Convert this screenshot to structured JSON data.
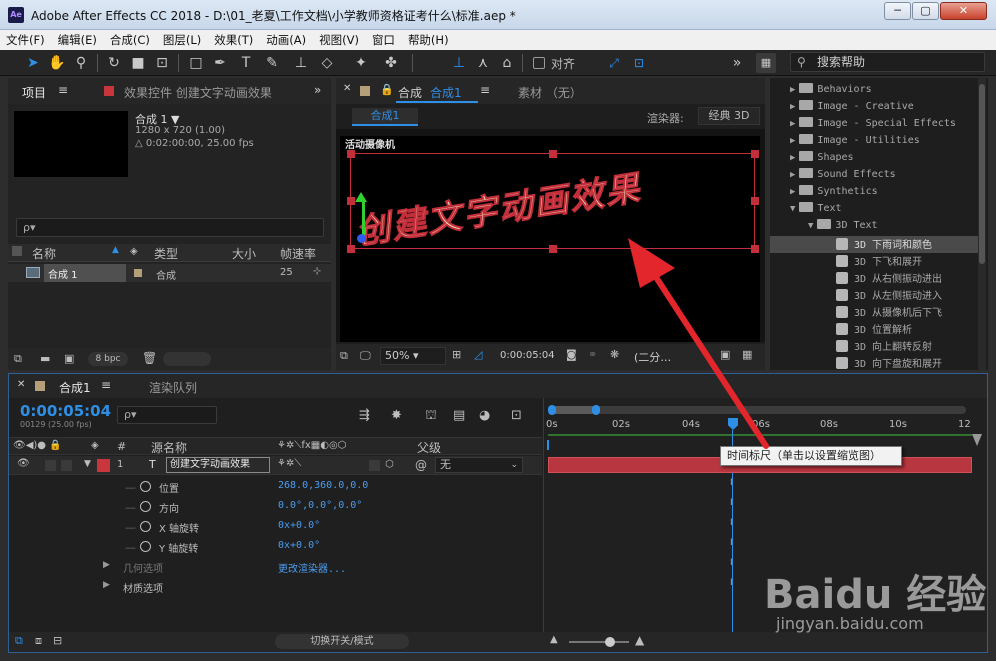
{
  "window": {
    "title": "Adobe After Effects CC 2018 - D:\\01_老夏\\工作文档\\小学教师资格证考什么\\标准.aep *",
    "app_icon": "Ae",
    "min": "─",
    "max": "▢",
    "close": "✕"
  },
  "menu": [
    "文件(F)",
    "编辑(E)",
    "合成(C)",
    "图层(L)",
    "效果(T)",
    "动画(A)",
    "视图(V)",
    "窗口",
    "帮助(H)"
  ],
  "toolbar": {
    "snap_label": "对齐",
    "search_label": "搜索帮助",
    "more": "»"
  },
  "project": {
    "tab": "项目",
    "effects_tab": "效果控件 创建文字动画效果",
    "comp_name": "合成 1 ▼",
    "comp_res": "1280 x 720 (1.00)",
    "comp_dur": "△ 0:02:00:00, 25.00 fps",
    "search_placeholder": "ρ▾",
    "columns": [
      "名称",
      "类型",
      "大小",
      "帧速率"
    ],
    "row": {
      "name": "合成 1",
      "type": "合成",
      "fps": "25"
    },
    "bpc": "8 bpc"
  },
  "composition": {
    "tab_prefix": "合成",
    "tab_name": "合成1",
    "footage_tab": "素材 （无）",
    "sub_tab": "合成1",
    "renderer_label": "渲染器:",
    "renderer": "经典 3D",
    "camera_label": "活动摄像机",
    "text": "创建文字动画效果",
    "zoom": "50%",
    "timecode": "0:00:05:04",
    "res": "(二分…"
  },
  "effects": {
    "items": [
      {
        "label": "Behaviors",
        "kind": "folder",
        "level": 1
      },
      {
        "label": "Image - Creative",
        "kind": "folder",
        "level": 1
      },
      {
        "label": "Image - Special Effects",
        "kind": "folder",
        "level": 1
      },
      {
        "label": "Image - Utilities",
        "kind": "folder",
        "level": 1
      },
      {
        "label": "Shapes",
        "kind": "folder",
        "level": 1
      },
      {
        "label": "Sound Effects",
        "kind": "folder",
        "level": 1
      },
      {
        "label": "Synthetics",
        "kind": "folder",
        "level": 1
      },
      {
        "label": "Text",
        "kind": "folder-open",
        "level": 1
      },
      {
        "label": "3D Text",
        "kind": "folder-open",
        "level": 2
      },
      {
        "label": "3D 下雨词和颜色",
        "kind": "preset",
        "level": 3
      },
      {
        "label": "3D 下飞和展开",
        "kind": "preset",
        "level": 3
      },
      {
        "label": "3D 从右侧振动进出",
        "kind": "preset",
        "level": 3
      },
      {
        "label": "3D 从左侧振动进入",
        "kind": "preset",
        "level": 3
      },
      {
        "label": "3D 从摄像机后下飞",
        "kind": "preset",
        "level": 3
      },
      {
        "label": "3D 位置解析",
        "kind": "preset",
        "level": 3
      },
      {
        "label": "3D 向上翻转反射",
        "kind": "preset",
        "level": 3
      },
      {
        "label": "3D 向下盘旋和展开",
        "kind": "preset",
        "level": 3
      }
    ]
  },
  "timeline": {
    "tab": "合成1",
    "render_tab": "渲染队列",
    "time": "0:00:05:04",
    "frames": "00129 (25.00 fps)",
    "search_placeholder": "ρ▾",
    "col_num": "#",
    "col_source": "源名称",
    "col_parent": "父级",
    "layer": {
      "num": "1",
      "type": "T",
      "name": "创建文字动画效果",
      "parent": "无"
    },
    "props": [
      {
        "name": "位置",
        "value": "268.0,360.0,0.0"
      },
      {
        "name": "方向",
        "value": "0.0°,0.0°,0.0°"
      },
      {
        "name": "X 轴旋转",
        "value": "0x+0.0°"
      },
      {
        "name": "Y 轴旋转",
        "value": "0x+0.0°"
      }
    ],
    "geometry": {
      "name": "几何选项",
      "value": "更改渲染器..."
    },
    "material": {
      "name": "材质选项"
    },
    "toggle_label": "切换开关/模式",
    "ruler": [
      "0s",
      "02s",
      "04s",
      "06s",
      "08s",
      "10s",
      "12"
    ],
    "tooltip": "时间标尺（单击以设置缩览图）"
  },
  "watermark": {
    "brand": "Baidu 经验",
    "url": "jingyan.baidu.com"
  },
  "colors": {
    "accent": "#2e8fe6",
    "arrow": "#e3252c",
    "track": "#b8363f",
    "label_red": "#c8353d"
  }
}
